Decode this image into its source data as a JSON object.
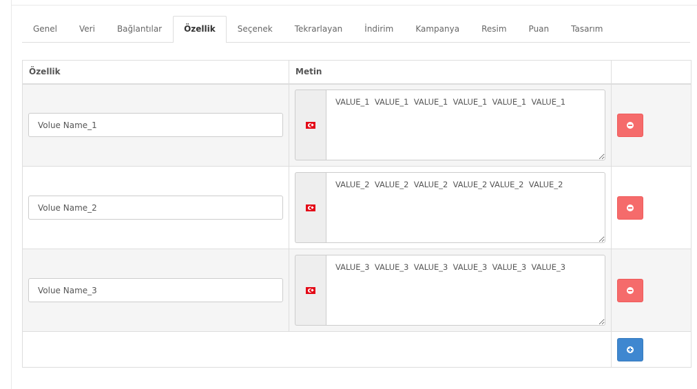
{
  "tabs": [
    {
      "label": "Genel",
      "active": false
    },
    {
      "label": "Veri",
      "active": false
    },
    {
      "label": "Bağlantılar",
      "active": false
    },
    {
      "label": "Özellik",
      "active": true
    },
    {
      "label": "Seçenek",
      "active": false
    },
    {
      "label": "Tekrarlayan",
      "active": false
    },
    {
      "label": "İndirim",
      "active": false
    },
    {
      "label": "Kampanya",
      "active": false
    },
    {
      "label": "Resim",
      "active": false
    },
    {
      "label": "Puan",
      "active": false
    },
    {
      "label": "Tasarım",
      "active": false
    }
  ],
  "table": {
    "headers": {
      "attribute": "Özellik",
      "text": "Metin",
      "action": ""
    },
    "rows": [
      {
        "name": "Volue Name_1",
        "text": "VALUE_1  VALUE_1  VALUE_1  VALUE_1  VALUE_1  VALUE_1"
      },
      {
        "name": "Volue Name_2",
        "text": "VALUE_2  VALUE_2  VALUE_2  VALUE_2 VALUE_2  VALUE_2"
      },
      {
        "name": "Volue Name_3",
        "text": "VALUE_3  VALUE_3  VALUE_3  VALUE_3  VALUE_3  VALUE_3"
      }
    ]
  },
  "icons": {
    "language_flag": "turkey-flag-icon",
    "remove": "minus-circle-icon",
    "add": "plus-circle-icon"
  },
  "colors": {
    "remove_button": "#f56b6b",
    "add_button": "#3f87d0",
    "row_shade": "#f5f5f5"
  }
}
